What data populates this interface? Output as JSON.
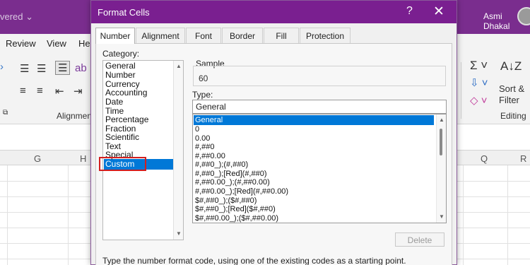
{
  "excel": {
    "doc_status": "vered ⌄",
    "user_name": "Asmi Dhakal",
    "menu": [
      "Review",
      "View",
      "He"
    ],
    "ribbon": {
      "alignment_label": "Alignmen",
      "sort_filter_line1": "Sort &",
      "sort_filter_line2": "Filter",
      "editing_label": "Editing"
    },
    "columns": [
      "G",
      "H",
      "Q",
      "R"
    ]
  },
  "dialog": {
    "title": "Format Cells",
    "help": "?",
    "close": "✕",
    "tabs": [
      "Number",
      "Alignment",
      "Font",
      "Border",
      "Fill",
      "Protection"
    ],
    "active_tab": "Number",
    "category_label": "Category:",
    "categories": [
      "General",
      "Number",
      "Currency",
      "Accounting",
      "Date",
      "Time",
      "Percentage",
      "Fraction",
      "Scientific",
      "Text",
      "Special",
      "Custom"
    ],
    "selected_category": "Custom",
    "sample_label": "Sample",
    "sample_value": "60",
    "type_label": "Type:",
    "type_value": "General",
    "formats": [
      "General",
      "0",
      "0.00",
      "#,##0",
      "#,##0.00",
      "#,##0_);(#,##0)",
      "#,##0_);[Red](#,##0)",
      "#,##0.00_);(#,##0.00)",
      "#,##0.00_);[Red](#,##0.00)",
      "$#,##0_);($#,##0)",
      "$#,##0_);[Red]($#,##0)",
      "$#,##0.00_);($#,##0.00)"
    ],
    "selected_format": "General",
    "delete_label": "Delete",
    "hint": "Type the number format code, using one of the existing codes as a starting point."
  }
}
